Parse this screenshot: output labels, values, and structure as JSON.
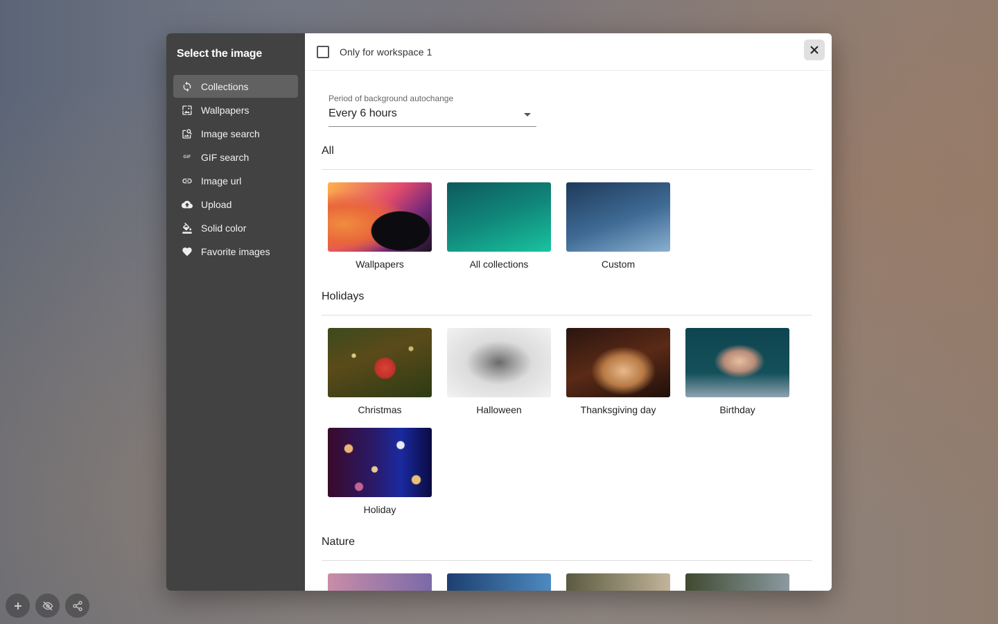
{
  "sidebar": {
    "title": "Select the image",
    "items": [
      {
        "label": "Collections",
        "icon": "refresh-icon",
        "active": true
      },
      {
        "label": "Wallpapers",
        "icon": "wallpaper-icon"
      },
      {
        "label": "Image search",
        "icon": "image-search-icon"
      },
      {
        "label": "GIF search",
        "icon": "gif-icon",
        "glyph": "GIF"
      },
      {
        "label": "Image url",
        "icon": "link-icon"
      },
      {
        "label": "Upload",
        "icon": "cloud-upload-icon"
      },
      {
        "label": "Solid color",
        "icon": "paint-bucket-icon"
      },
      {
        "label": "Favorite images",
        "icon": "heart-icon"
      }
    ]
  },
  "topbar": {
    "checkbox_label": "Only for workspace 1",
    "checked": false
  },
  "autochange": {
    "label": "Period of background autochange",
    "value": "Every 6 hours"
  },
  "sections": [
    {
      "title": "All",
      "items": [
        {
          "label": "Wallpapers",
          "thumb": "t-wallpapers"
        },
        {
          "label": "All collections",
          "thumb": "t-allcol"
        },
        {
          "label": "Custom",
          "thumb": "t-custom"
        }
      ]
    },
    {
      "title": "Holidays",
      "items": [
        {
          "label": "Christmas",
          "thumb": "t-christmas"
        },
        {
          "label": "Halloween",
          "thumb": "t-halloween"
        },
        {
          "label": "Thanksgiving day",
          "thumb": "t-thanks"
        },
        {
          "label": "Birthday",
          "thumb": "t-birthday"
        },
        {
          "label": "Holiday",
          "thumb": "t-holiday"
        }
      ]
    },
    {
      "title": "Nature",
      "items": [
        {
          "label": "",
          "thumb": "t-nature1"
        },
        {
          "label": "",
          "thumb": "t-nature2"
        },
        {
          "label": "",
          "thumb": "t-nature3"
        },
        {
          "label": "",
          "thumb": "t-nature4"
        }
      ]
    }
  ],
  "fabs": [
    {
      "icon": "plus-icon"
    },
    {
      "icon": "eye-off-icon"
    },
    {
      "icon": "share-icon"
    }
  ]
}
